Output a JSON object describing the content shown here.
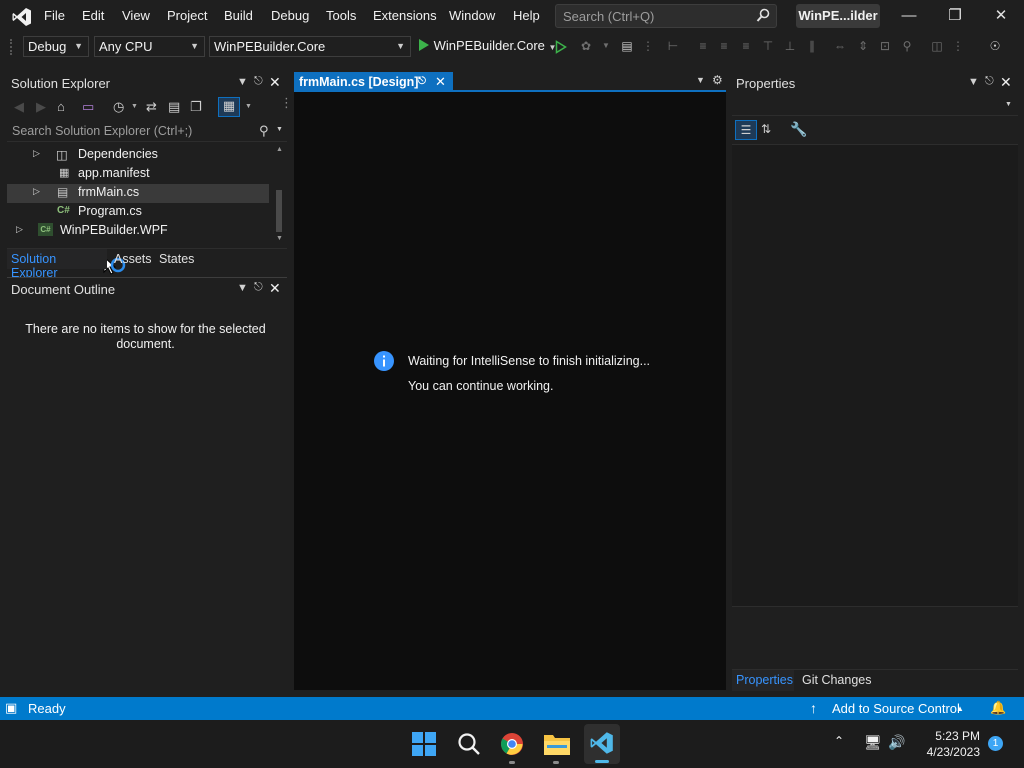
{
  "menu": [
    "File",
    "Edit",
    "View",
    "Project",
    "Build",
    "Debug",
    "Tools",
    "Extensions",
    "Window",
    "Help"
  ],
  "search": {
    "placeholder": "Search (Ctrl+Q)"
  },
  "solution_badge": "WinPE...ilder",
  "toolbar": {
    "config": "Debug",
    "platform": "Any CPU",
    "startup_project": "WinPEBuilder.Core",
    "run_target": "WinPEBuilder.Core"
  },
  "solution_explorer": {
    "title": "Solution Explorer",
    "search_placeholder": "Search Solution Explorer (Ctrl+;)",
    "items": [
      {
        "label": "Dependencies",
        "icon": "dependencies-icon"
      },
      {
        "label": "app.manifest",
        "icon": "manifest-icon"
      },
      {
        "label": "frmMain.cs",
        "icon": "form-icon"
      },
      {
        "label": "Program.cs",
        "icon": "csharp-file-icon"
      },
      {
        "label": "WinPEBuilder.WPF",
        "icon": "csharp-project-icon"
      }
    ],
    "tabs": [
      "Solution Explorer",
      "Assets",
      "States"
    ]
  },
  "document_outline": {
    "title": "Document Outline",
    "empty_message": "There are no items to show for the selected document."
  },
  "editor": {
    "tab_label": "frmMain.cs [Design]",
    "info_line1": "Waiting for IntelliSense to finish initializing...",
    "info_line2": "You can continue working."
  },
  "properties": {
    "title": "Properties",
    "tabs": [
      "Properties",
      "Git Changes"
    ]
  },
  "status": {
    "text": "Ready",
    "source_control": "Add to Source Control"
  },
  "taskbar": {
    "time": "5:23 PM",
    "date": "4/23/2023",
    "notification_count": "1"
  },
  "colors": {
    "accent": "#007acc",
    "tab_active": "#0e70c0",
    "run_green": "#3cb24a"
  }
}
